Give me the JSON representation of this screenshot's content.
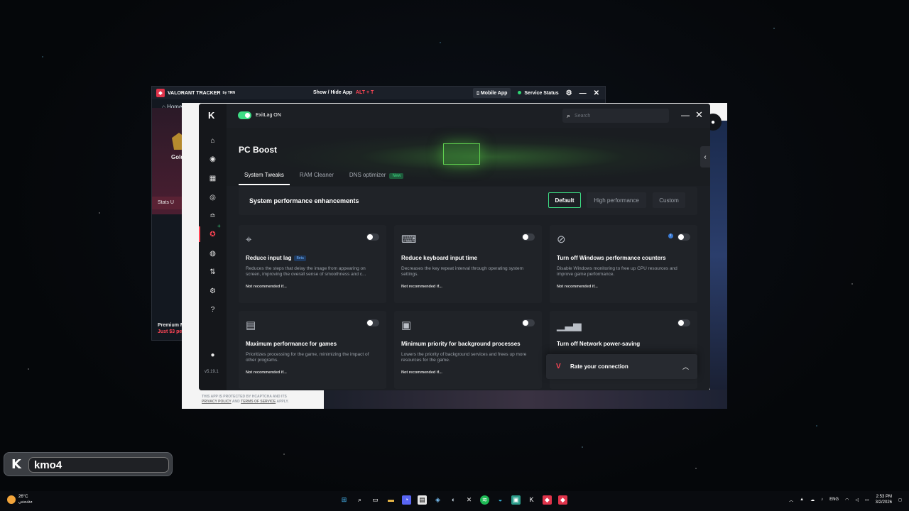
{
  "tracker": {
    "brand": "VALORANT TRACKER",
    "brand_by": "by TRN",
    "show_hide": "Show / Hide App",
    "shortcut": "ALT + T",
    "mobile_app": "Mobile App",
    "service_status": "Service Status",
    "nav_home": "Home",
    "rank": "Gold",
    "stats": "Stats U",
    "premium_line1": "Premium M",
    "premium_line2": "Just $3 per"
  },
  "app": {
    "toggle_label": "ExitLag ON",
    "search_placeholder": "Search",
    "page_title": "PC Boost",
    "version": "v5.19.1",
    "tabs": [
      {
        "label": "System Tweaks",
        "active": true
      },
      {
        "label": "RAM Cleaner",
        "active": false
      },
      {
        "label": "DNS optimizer",
        "active": false,
        "badge": "New"
      }
    ],
    "performance": {
      "title": "System performance enhancements",
      "options": [
        "Default",
        "High performance",
        "Custom"
      ],
      "selected": "Default"
    },
    "cards": [
      {
        "title": "Reduce input lag",
        "badge": "Beta",
        "desc": "Reduces the steps that delay the image from appearing on screen, improving the overall sense of smoothness and c...",
        "note": "Not recommended if...",
        "enabled": false
      },
      {
        "title": "Reduce keyboard input time",
        "desc": "Decreases the key repeat interval through operating system settings.",
        "note": "Not recommended if...",
        "enabled": false
      },
      {
        "title": "Turn off Windows performance counters",
        "desc": "Disable Windows monitoring to free up CPU resources and improve game performance.",
        "note": "Not recommended if...",
        "enabled": false
      },
      {
        "title": "Maximum performance for games",
        "desc": "Prioritizes processing for the game, minimizing the impact of other programs.",
        "note": "Not recommended if...",
        "enabled": false
      },
      {
        "title": "Minimum priority for background processes",
        "desc": "Lowers the priority of background services and frees up more resources for the game.",
        "note": "Not recommended if...",
        "enabled": false
      },
      {
        "title": "Turn off Network power-saving",
        "desc": "",
        "note": "",
        "enabled": false
      }
    ],
    "rate": "Rate your connection"
  },
  "captcha": {
    "line1": "THIS APP IS PROTECTED BY HCAPTCHA AND ITS",
    "privacy": "PRIVACY POLICY",
    "and": "AND",
    "terms": "TERMS OF SERVICE",
    "apply": "APPLY."
  },
  "streamer": {
    "name": "kmo4"
  },
  "taskbar": {
    "temp": "26°C",
    "weather_sub": "مشمس",
    "lang": "ENG",
    "time": "2:53 PM",
    "date": "3/2/2026"
  },
  "colors": {
    "accent_green": "#3ddc84",
    "accent_red": "#ff4454"
  }
}
